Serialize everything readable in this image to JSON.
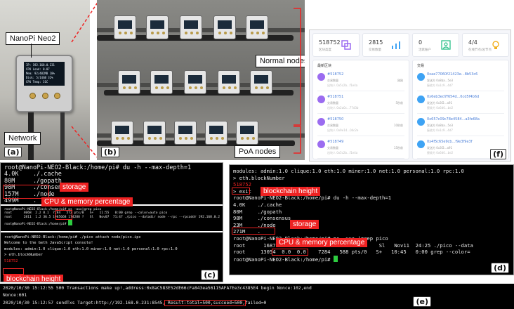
{
  "panel_a": {
    "label": "(a)",
    "device_callout": "NanoPi Neo2",
    "network_callout": "Network",
    "lcd_lines": [
      "IP: 192.168.0.231",
      "CPU Load: 0.07",
      "Mem: 92/482MB 18%",
      "Disk: 5/14GB 32%",
      "CPU Temp: 31C"
    ]
  },
  "panel_b": {
    "label": "(b)",
    "normal_callout": "Normal nodes",
    "poa_callout": "PoA nodes"
  },
  "panel_f": {
    "label": "(f)",
    "stats": [
      {
        "value": "518752",
        "sub": "区块高度",
        "icon": "blocks-icon"
      },
      {
        "value": "2815",
        "sub": "交易数量",
        "icon": "bar-chart-icon"
      },
      {
        "value": "0",
        "sub": "活跃账户",
        "icon": "user-icon"
      },
      {
        "value": "4/4",
        "sub": "在线节点/总节点",
        "icon": "lightbulb-icon"
      }
    ],
    "blocks_title": "最新区块",
    "blocks": [
      {
        "id": "#518752",
        "line1": "交易数量",
        "line2": "出块人 0x5c2b...f1e4a",
        "time": "刚刚"
      },
      {
        "id": "#518751",
        "line1": "交易数量",
        "line2": "出块人 0x2a0c...77d3b",
        "time": "5秒前"
      },
      {
        "id": "#518750",
        "line1": "交易数量",
        "line2": "出块人 0x9e14...04c2e",
        "time": "10秒前"
      },
      {
        "id": "#518749",
        "line1": "交易数量",
        "line2": "出块人 0x5c2b...f1e4a",
        "time": "15秒前"
      }
    ],
    "tx_title": "交易",
    "txs": [
      {
        "hash": "0xae77060f21423e...8b53c6",
        "from": "发送方 0x8ba...5e3",
        "to": "接收方 0x1c9...4d7"
      },
      {
        "hash": "0x6eb3ed7f654d...6cd5f4b6d",
        "from": "发送方 0x3f2...a91",
        "to": "接收方 0x6d0...be2"
      },
      {
        "hash": "0x657c09c78e4584...a3fe68a",
        "from": "发送方 0x8ba...5e3",
        "to": "接收方 0x1c9...4d7"
      },
      {
        "hash": "0x4f5c65e9cb...f9e3f9e3f",
        "from": "发送方 0x3f2...a91",
        "to": "接收方 0x6d0...be2"
      }
    ]
  },
  "panel_c": {
    "label": "(c)",
    "du_lines": [
      "root@NanoPi-NEO2-Black:/home/pi# du -h --max-depth=1",
      "4.0K    ./.cache",
      "80M     ./gopath",
      "98M     ./consensus",
      "157M    ./node",
      "499M    .",
      "root@NanoPi-NEO2-Black:/home/pi# "
    ],
    "storage_tag": "storage",
    "ps_lines": [
      "root@NanoPi-NEO2-Black:/home/pi# ps -aux|grep pico",
      "root      4068  2.2 8.1  7284   572 pts/0   S+   11:55   0:00 grep --color=auto pico",
      "root      2811  1.2 36.5 1985668 174288 ?   Sl   Nov07  71:47 ./pico --datadir node --rpc --rpcaddr 192.168.0.2",
      "root@NanoPi-NEO2-Black:/home/pi# "
    ],
    "cpu_tag": "CPU & memory percentage",
    "geth_lines": [
      "root@NanoPi-NEO2-Black:/home/pi# ./pico attach node/pico.ipc",
      "Welcome to the Geth JavaScript console!",
      "",
      "modules: admin:1.0 clique:1.0 eth:1.0 miner:1.0 net:1.0 personal:1.0 rpc:1.0",
      "",
      "> eth.blockNumber",
      "518752"
    ],
    "height_tag": "blockchain height"
  },
  "panel_d": {
    "label": "(d)",
    "lines": [
      "modules: admin:1.0 clique:1.0 eth:1.0 miner:1.0 net:1.0 personal:1.0 rpc:1.0",
      "",
      "> eth.blockNumber",
      "518752",
      "> exit",
      "root@NanoPi-NEO2-Black:/home/pi# du -h --max-depth=1",
      "4.0K    ./.cache",
      "80M     ./gopath",
      "98M     ./consensus",
      "23M     ./node",
      "271M    .",
      "root@NanoPi-NEO2-Black:/home/pi# ps -xua |grep pico",
      "root      1687  0.7 39.8  1612276  404612 ?     Sl   Nov11  24:25 ./pico --data",
      "root     13054  0.0  0.0    7284   588 pts/0   S+   10:45   0:00 grep --color=",
      "root@NanoPi-NEO2-Black:/home/pi# "
    ],
    "height_tag": "blockchain height",
    "storage_tag": "storage",
    "cpu_tag": "CPU & memory percentage"
  },
  "panel_e": {
    "label": "(e)",
    "line1": "2020/10/30 15:12:55 500 Transactions make up!,address:0x8aC583E52dE66cFa843ea56115AFA7Ee3c4385E4 begin Nonce:102,end",
    "line2": "Nonce:601",
    "line3_prefix": "2020/10/30 15:12:57 sendTxs Target:http://192.168.0.231:8545,",
    "line3_result": " Result:total=500,succeed=500,",
    "line3_suffix": "failed=0"
  },
  "colors": {
    "highlight": "#e22222",
    "terminal_bg": "#000000",
    "prompt_cursor": "#2ecc40",
    "explorer_accent": "#9b6cf0"
  }
}
